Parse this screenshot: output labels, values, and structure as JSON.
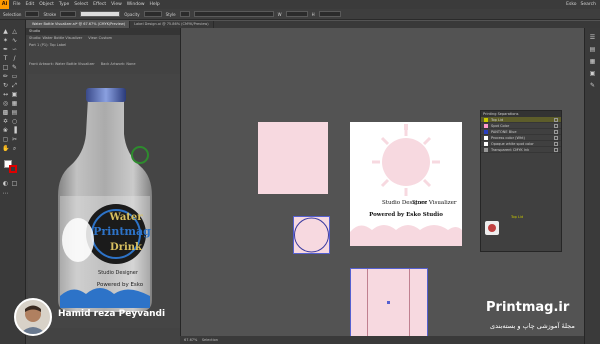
{
  "menu": {
    "app_badge": "Ai",
    "items": [
      "File",
      "Edit",
      "Object",
      "Type",
      "Select",
      "Effect",
      "View",
      "Window",
      "Help"
    ],
    "right": [
      "Esko",
      "Search"
    ]
  },
  "control_bar": {
    "selection": "Selection",
    "stroke_label": "Stroke",
    "opacity_label": "Opacity",
    "style_label": "Style",
    "width_label": "W",
    "height_label": "H"
  },
  "tabs": [
    {
      "label": "Water Bottle Visualizer.ai* @ 67.67% (CMYK/Preview)",
      "active": true
    },
    {
      "label": "Label Design.ai @ 75.86% (CMYK/Preview)",
      "active": false
    }
  ],
  "visualizer_panel": {
    "title": "Studio",
    "row1": [
      "Studio: Water Bottle Visualizer",
      "View: Custom"
    ],
    "row2": [
      "Part 1 (P1): Top Label"
    ],
    "row3": [
      "Front Artwork: Water Bottle Visualizer",
      "Back Artwork: None"
    ]
  },
  "bottle_label": {
    "line1": "Water",
    "line2": "Printmag",
    "line3": "Drink",
    "line4": "Studio Designer",
    "line5": "Powered by Esko"
  },
  "white_artboard": {
    "line1": "Studio Designer",
    "line2": "Store Visualizer",
    "line3": "Powered by Esko Studio"
  },
  "separations": {
    "title": "Printing Separations",
    "rows": [
      {
        "label": "Top Lid",
        "color": "#c8c800",
        "selected": true
      },
      {
        "label": "Spot Color",
        "color": "#ff99cc",
        "selected": false
      },
      {
        "label": "PANTONE Blue",
        "color": "#2a3fbf",
        "selected": false
      },
      {
        "label": "Process color (Wht)",
        "color": "#ffffff",
        "selected": false
      },
      {
        "label": "Opaque white spot color",
        "color": "#ffffff",
        "selected": false
      },
      {
        "label": "Transparent CMYK Ink",
        "color": "#999999",
        "selected": false
      }
    ],
    "footer": "Top Lid"
  },
  "status": {
    "zoom": "67.67%",
    "tool": "Selection"
  },
  "presenter": {
    "name": "Hamid reza Peyvandi"
  },
  "brand": {
    "name": "Printmag.ir",
    "tagline": "مجلهٔ آموزشی چاپ و بسته‌بندی"
  }
}
